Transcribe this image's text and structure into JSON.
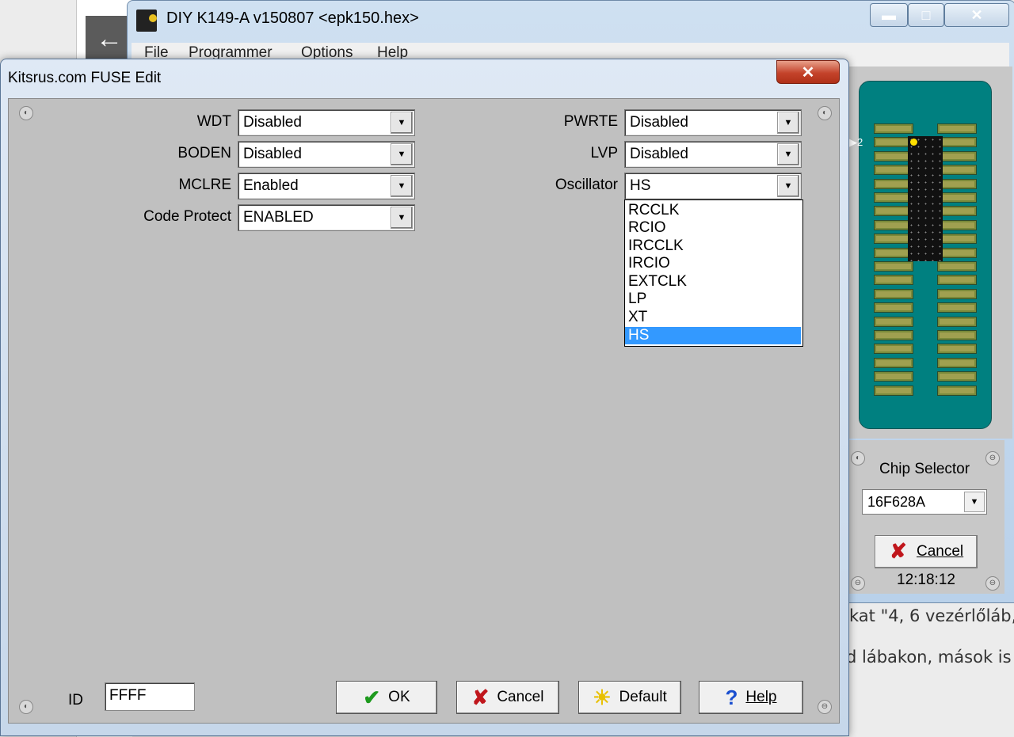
{
  "background": {
    "text_line1": "kat \"4, 6 vezérlőláb,",
    "text_line2": "d lábakon, mások is"
  },
  "main_window": {
    "title": "DIY K149-A v150807  <epk150.hex>",
    "menu": [
      "File",
      "Programmer",
      "Options",
      "Help"
    ],
    "chip_selector_label": "Chip Selector",
    "chip_value": "16F628A",
    "cancel_label": "Cancel",
    "time": "12:18:12",
    "pin_marker": "2"
  },
  "dialog": {
    "title": "Kitsrus.com FUSE Edit",
    "fields_left": [
      {
        "label": "WDT",
        "value": "Disabled"
      },
      {
        "label": "BODEN",
        "value": "Disabled"
      },
      {
        "label": "MCLRE",
        "value": "Enabled"
      },
      {
        "label": "Code Protect",
        "value": "ENABLED"
      }
    ],
    "fields_right": [
      {
        "label": "PWRTE",
        "value": "Disabled"
      },
      {
        "label": "LVP",
        "value": "Disabled"
      },
      {
        "label": "Oscillator",
        "value": "HS"
      }
    ],
    "oscillator_options": [
      "RCCLK",
      "RCIO",
      "IRCCLK",
      "IRCIO",
      "EXTCLK",
      "LP",
      "XT",
      "HS"
    ],
    "oscillator_selected": "HS",
    "id_label": "ID",
    "id_value": "FFFF",
    "buttons": {
      "ok": "OK",
      "cancel": "Cancel",
      "default": "Default",
      "help": "Help"
    }
  },
  "colors": {
    "selection": "#3399ff",
    "socket": "#008080",
    "client_bg": "#c0c0c0"
  }
}
